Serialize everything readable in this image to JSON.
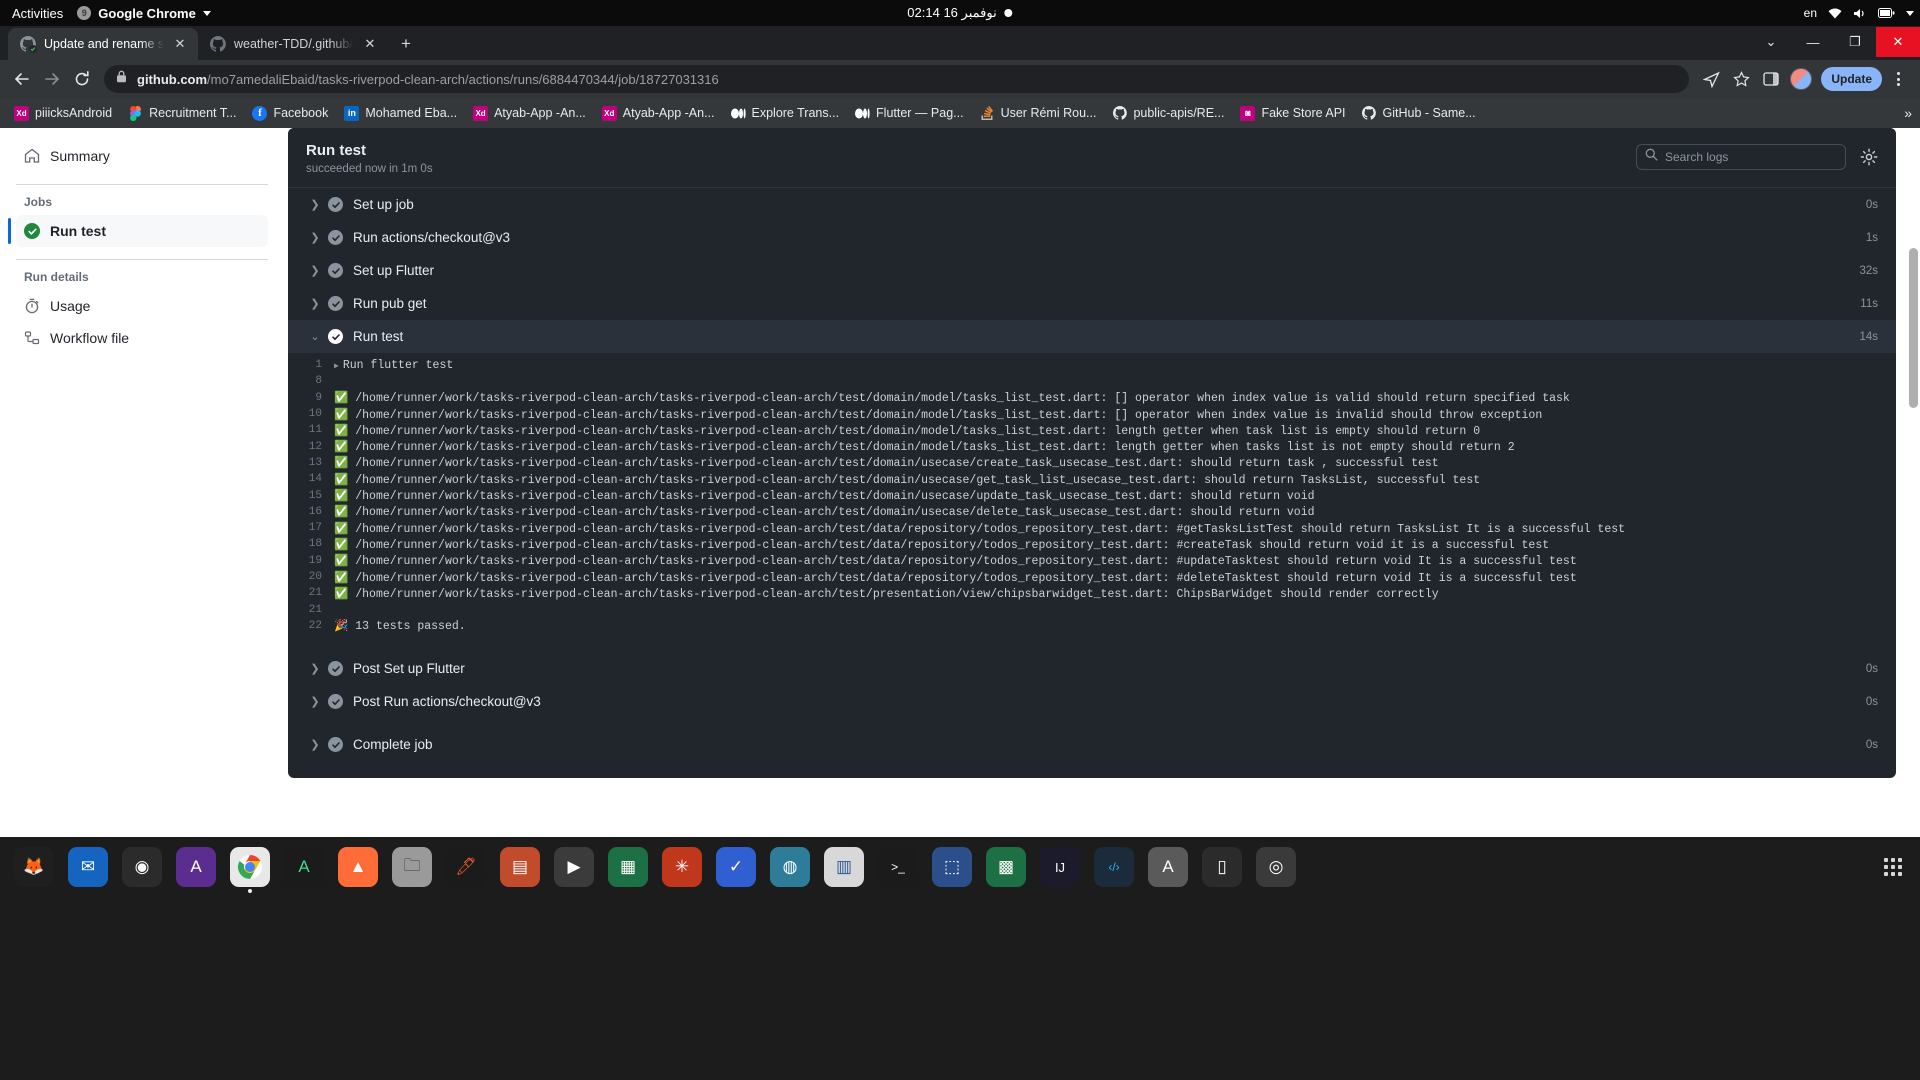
{
  "os_bar": {
    "activities": "Activities",
    "app_name": "Google Chrome",
    "clock": "02:14 نوفمبر 16",
    "keyboard_layout": "en"
  },
  "browser": {
    "tabs": [
      {
        "title": "Update and rename static",
        "favicon": "github-icon",
        "active": true
      },
      {
        "title": "weather-TDD/.github/wo",
        "favicon": "github-icon",
        "active": false
      }
    ],
    "new_tab_label": "+",
    "url_domain": "github.com",
    "url_path": "/mo7amedaliEbaid/tasks-riverpod-clean-arch/actions/runs/6884470344/job/18727031316",
    "update_button": "Update",
    "bookmarks": [
      {
        "label": "piiicksAndroid",
        "icon": "xd-icon",
        "color": "#c1007f",
        "glyph": "Xd"
      },
      {
        "label": "Recruitment T...",
        "icon": "figma-icon",
        "color": "transparent",
        "glyph": ""
      },
      {
        "label": "Facebook",
        "icon": "facebook-icon",
        "color": "#1877f2",
        "glyph": "f"
      },
      {
        "label": "Mohamed Eba...",
        "icon": "linkedin-icon",
        "color": "#0a66c2",
        "glyph": "in"
      },
      {
        "label": "Atyab-App -An...",
        "icon": "xd-icon",
        "color": "#c1007f",
        "glyph": "Xd"
      },
      {
        "label": "Atyab-App -An...",
        "icon": "xd-icon",
        "color": "#c1007f",
        "glyph": "Xd"
      },
      {
        "label": "Explore Trans...",
        "icon": "medium-icon",
        "color": "#000000",
        "glyph": ""
      },
      {
        "label": "Flutter — Pag...",
        "icon": "medium-icon",
        "color": "#000000",
        "glyph": ""
      },
      {
        "label": "User Rémi Rou...",
        "icon": "stackoverflow-icon",
        "color": "transparent",
        "glyph": ""
      },
      {
        "label": "public-apis/RE...",
        "icon": "github-icon",
        "color": "transparent",
        "glyph": ""
      },
      {
        "label": "Fake Store API",
        "icon": "fakestore-icon",
        "color": "#c1007f",
        "glyph": "◙"
      },
      {
        "label": "GitHub - Same...",
        "icon": "github-icon",
        "color": "transparent",
        "glyph": ""
      }
    ],
    "bookmarks_overflow": "»"
  },
  "sidebar": {
    "summary": {
      "label": "Summary",
      "icon": "home-icon"
    },
    "jobs_heading": "Jobs",
    "jobs": [
      {
        "label": "Run test",
        "status": "success",
        "selected": true
      }
    ],
    "run_details_heading": "Run details",
    "run_details": [
      {
        "label": "Usage",
        "icon": "stopwatch-icon"
      },
      {
        "label": "Workflow file",
        "icon": "workflow-icon"
      }
    ]
  },
  "log_panel": {
    "title": "Run test",
    "subtitle": "succeeded now in 1m 0s",
    "search_placeholder": "Search logs",
    "search_value": "",
    "gear_label": "gear-icon",
    "steps": [
      {
        "name": "Set up job",
        "time": "0s",
        "expanded": false
      },
      {
        "name": "Run actions/checkout@v3",
        "time": "1s",
        "expanded": false
      },
      {
        "name": "Set up Flutter",
        "time": "32s",
        "expanded": false
      },
      {
        "name": "Run pub get",
        "time": "11s",
        "expanded": false
      },
      {
        "name": "Run test",
        "time": "14s",
        "expanded": true
      },
      {
        "name": "Post Set up Flutter",
        "time": "0s",
        "expanded": false
      },
      {
        "name": "Post Run actions/checkout@v3",
        "time": "0s",
        "expanded": false
      },
      {
        "name": "Complete job",
        "time": "0s",
        "expanded": false
      }
    ],
    "log_lines": [
      {
        "n": "1",
        "kind": "group",
        "text": "Run flutter test"
      },
      {
        "n": "8",
        "kind": "blank",
        "text": ""
      },
      {
        "n": "9",
        "kind": "pass",
        "text": "/home/runner/work/tasks-riverpod-clean-arch/tasks-riverpod-clean-arch/test/domain/model/tasks_list_test.dart: [] operator when index value is valid should return specified task"
      },
      {
        "n": "10",
        "kind": "pass",
        "text": "/home/runner/work/tasks-riverpod-clean-arch/tasks-riverpod-clean-arch/test/domain/model/tasks_list_test.dart: [] operator when index value is invalid should throw exception"
      },
      {
        "n": "11",
        "kind": "pass",
        "text": "/home/runner/work/tasks-riverpod-clean-arch/tasks-riverpod-clean-arch/test/domain/model/tasks_list_test.dart: length getter when task list is empty should return 0"
      },
      {
        "n": "12",
        "kind": "pass",
        "text": "/home/runner/work/tasks-riverpod-clean-arch/tasks-riverpod-clean-arch/test/domain/model/tasks_list_test.dart: length getter when tasks list is not empty should return 2"
      },
      {
        "n": "13",
        "kind": "pass",
        "text": "/home/runner/work/tasks-riverpod-clean-arch/tasks-riverpod-clean-arch/test/domain/usecase/create_task_usecase_test.dart: should return task , successful test"
      },
      {
        "n": "14",
        "kind": "pass",
        "text": "/home/runner/work/tasks-riverpod-clean-arch/tasks-riverpod-clean-arch/test/domain/usecase/get_task_list_usecase_test.dart: should return TasksList, successful test"
      },
      {
        "n": "15",
        "kind": "pass",
        "text": "/home/runner/work/tasks-riverpod-clean-arch/tasks-riverpod-clean-arch/test/domain/usecase/update_task_usecase_test.dart: should return void"
      },
      {
        "n": "16",
        "kind": "pass",
        "text": "/home/runner/work/tasks-riverpod-clean-arch/tasks-riverpod-clean-arch/test/domain/usecase/delete_task_usecase_test.dart: should return void"
      },
      {
        "n": "17",
        "kind": "pass",
        "text": "/home/runner/work/tasks-riverpod-clean-arch/tasks-riverpod-clean-arch/test/data/repository/todos_repository_test.dart: #getTasksListTest should return TasksList It is a successful test"
      },
      {
        "n": "18",
        "kind": "pass",
        "text": "/home/runner/work/tasks-riverpod-clean-arch/tasks-riverpod-clean-arch/test/data/repository/todos_repository_test.dart: #createTask should return void it is a successful test"
      },
      {
        "n": "19",
        "kind": "pass",
        "text": "/home/runner/work/tasks-riverpod-clean-arch/tasks-riverpod-clean-arch/test/data/repository/todos_repository_test.dart: #updateTasktest should return void It is a successful test"
      },
      {
        "n": "20",
        "kind": "pass",
        "text": "/home/runner/work/tasks-riverpod-clean-arch/tasks-riverpod-clean-arch/test/data/repository/todos_repository_test.dart: #deleteTasktest should return void It is a successful test"
      },
      {
        "n": "21",
        "kind": "pass",
        "text": "/home/runner/work/tasks-riverpod-clean-arch/tasks-riverpod-clean-arch/test/presentation/view/chipsbarwidget_test.dart: ChipsBarWidget should render correctly"
      },
      {
        "n": "21",
        "kind": "blank",
        "text": ""
      },
      {
        "n": "22",
        "kind": "celebrate",
        "text": "13 tests passed."
      }
    ]
  },
  "dock": {
    "items": [
      {
        "name": "firefox",
        "glyph": "🦊",
        "color": "#1f1f1f",
        "running": false
      },
      {
        "name": "thunderbird",
        "glyph": "✉",
        "color": "#1565c0",
        "running": false
      },
      {
        "name": "rhythmbox",
        "glyph": "◉",
        "color": "#2b2b2b",
        "running": false
      },
      {
        "name": "ubuntu-software",
        "glyph": "A",
        "color": "#5c2d91",
        "running": false
      },
      {
        "name": "google-chrome",
        "glyph": "",
        "color": "#e8e8e8",
        "running": true
      },
      {
        "name": "android-studio",
        "glyph": "A",
        "color": "#1b1b1b",
        "running": false
      },
      {
        "name": "postman",
        "glyph": "▲",
        "color": "#ff6c37",
        "running": false
      },
      {
        "name": "files",
        "glyph": "🗀",
        "color": "#9a9a9a",
        "running": false
      },
      {
        "name": "gitkraken",
        "glyph": "🖊",
        "color": "#1b1b1b",
        "running": false
      },
      {
        "name": "slides",
        "glyph": "▤",
        "color": "#c24b2b",
        "running": false
      },
      {
        "name": "video-player",
        "glyph": "▶",
        "color": "#3b3b3b",
        "running": false
      },
      {
        "name": "excel",
        "glyph": "▦",
        "color": "#1d7044",
        "running": false
      },
      {
        "name": "settings",
        "glyph": "✳",
        "color": "#c1371c",
        "running": false
      },
      {
        "name": "todo",
        "glyph": "✓",
        "color": "#2f5fd0",
        "running": false
      },
      {
        "name": "browser-alt",
        "glyph": "◍",
        "color": "#2d7d9a",
        "running": false
      },
      {
        "name": "libreoffice-writer",
        "glyph": "▥",
        "color": "#d8d8d8",
        "running": false
      },
      {
        "name": "terminal",
        "glyph": ">_",
        "color": "#1b1b1b",
        "running": false
      },
      {
        "name": "screenshot",
        "glyph": "⬚",
        "color": "#2b4f8a",
        "running": false
      },
      {
        "name": "calc",
        "glyph": "▩",
        "color": "#1d7044",
        "running": false
      },
      {
        "name": "intellij",
        "glyph": "IJ",
        "color": "#1b1b2b",
        "running": false
      },
      {
        "name": "vscode",
        "glyph": "‹/›",
        "color": "#1b2b3b",
        "running": false
      },
      {
        "name": "appimage",
        "glyph": "A",
        "color": "#5a5a5a",
        "running": false
      },
      {
        "name": "device",
        "glyph": "▯",
        "color": "#2b2b2b",
        "running": false
      },
      {
        "name": "disc",
        "glyph": "◎",
        "color": "#3a3a3a",
        "running": false
      }
    ],
    "show_apps": "show-applications-icon"
  }
}
